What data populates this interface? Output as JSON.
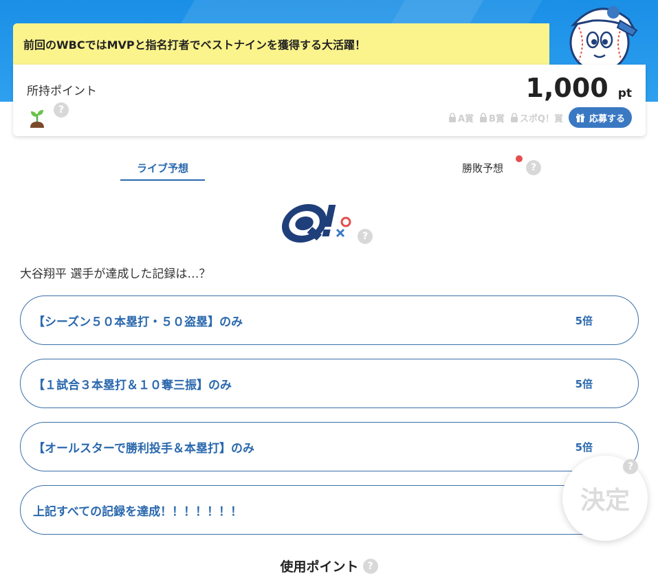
{
  "banner": {
    "text": "前回のWBCではMVPと指名打者でベストナインを獲得する大活躍！"
  },
  "points": {
    "label": "所持ポイント",
    "value": "1,000",
    "unit": "pt",
    "help": "?"
  },
  "prizes": [
    {
      "label": "A賞",
      "locked": true
    },
    {
      "label": "B賞",
      "locked": true
    },
    {
      "label": "スポQ！賞",
      "locked": true
    }
  ],
  "apply_button": {
    "label": "応募する"
  },
  "tabs": {
    "live": "ライブ予想",
    "win_lose": "勝敗予想",
    "help": "?"
  },
  "logo": {
    "help": "?"
  },
  "question": "大谷翔平 選手が達成した記録は…？",
  "options": [
    {
      "label": "【シーズン５０本塁打・５０盗塁】のみ",
      "multiplier": "5倍"
    },
    {
      "label": "【１試合３本塁打＆１０奪三振】のみ",
      "multiplier": "5倍"
    },
    {
      "label": "【オールスターで勝利投手＆本塁打】のみ",
      "multiplier": "5倍"
    },
    {
      "label": "上記すべての記録を達成！！！！！！！",
      "multiplier": ""
    }
  ],
  "decide_button": {
    "label": "決定",
    "help": "?"
  },
  "use_points": {
    "label": "使用ポイント",
    "help": "?"
  },
  "colors": {
    "header_blue": "#1a8fe6",
    "banner_yellow": "#fbf48c",
    "accent_blue": "#2a68ad",
    "badge_red": "#e34e4e"
  }
}
